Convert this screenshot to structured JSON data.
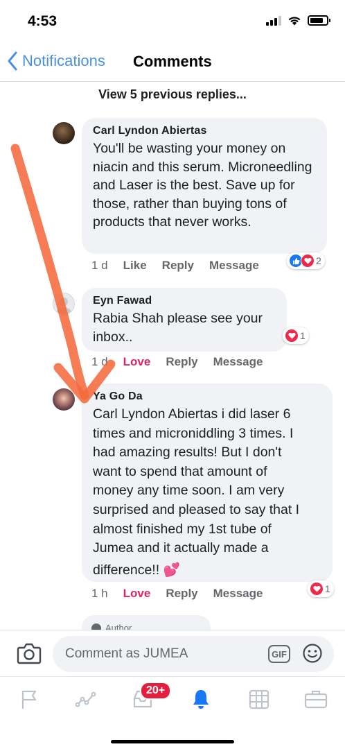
{
  "status_bar": {
    "time": "4:53"
  },
  "nav": {
    "back_label": "Notifications",
    "title": "Comments"
  },
  "comments": {
    "view_previous": "View 5 previous replies...",
    "items": [
      {
        "author": "Carl Lyndon Abiertas",
        "text": "You'll be wasting your money on niacin and this serum. Microneedling and Laser is the best. Save up for those, rather than buying tons of products that never works.",
        "time": "1 d",
        "like_label": "Like",
        "reply_label": "Reply",
        "message_label": "Message",
        "reaction_count": "2",
        "reactions": [
          "like-icon",
          "heart-icon"
        ]
      },
      {
        "author": "Eyn Fawad",
        "text": "Rabia Shah please see your inbox..",
        "time": "1 d",
        "like_label": "Love",
        "reply_label": "Reply",
        "message_label": "Message",
        "reaction_count": "1",
        "reactions": [
          "heart-icon"
        ]
      },
      {
        "author": "Ya Go Da",
        "text_lines": [
          "Carl Lyndon Abiertas  i did laser 6",
          "times and microniddling 3 times. I",
          "had amazing results! But I don't",
          "want to spend that amount of",
          "money any time soon. I am very",
          "surprised and pleased to say that I",
          "almost finished my 1st tube of",
          "Jumea and it actually made a",
          "difference!! 💕"
        ],
        "time": "1 h",
        "like_label": "Love",
        "reply_label": "Reply",
        "message_label": "Message",
        "reaction_count": "1",
        "reactions": [
          "heart-icon"
        ]
      }
    ],
    "partial_badge": "Author"
  },
  "composer": {
    "placeholder": "Comment as JUMEA",
    "gif_label": "GIF"
  },
  "tab_bar": {
    "notifications_badge": "20+"
  },
  "colors": {
    "accent_blue": "#4a90e2",
    "love_red": "#e0245e",
    "annotation_orange": "#f46a3c",
    "bubble_gray": "#f0f2f5",
    "badge_red": "#e41e3f"
  }
}
